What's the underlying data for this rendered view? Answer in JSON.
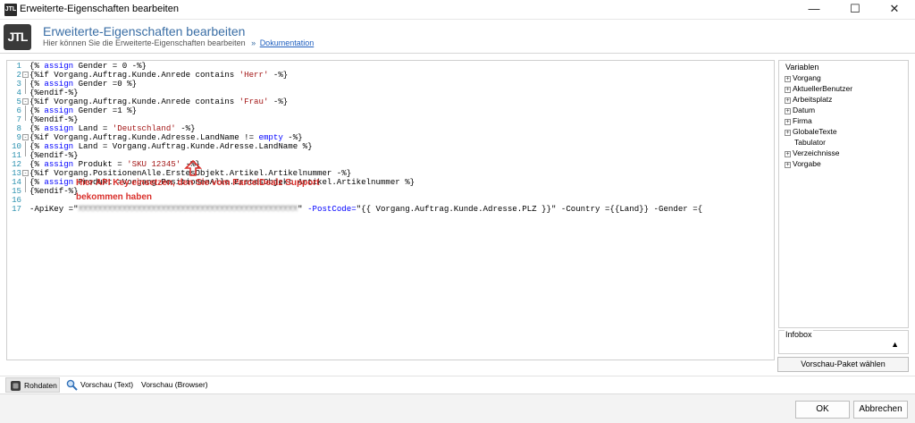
{
  "window": {
    "app_icon_text": "JTL",
    "title": "Erweiterte-Eigenschaften bearbeiten",
    "minimize_glyph": "—",
    "maximize_glyph": "☐",
    "close_glyph": "✕"
  },
  "header": {
    "logo_text": "JTL",
    "title": "Erweiterte-Eigenschaften bearbeiten",
    "subtitle": "Hier können Sie die Erweiterte-Eigenschaften bearbeiten",
    "separator": "»",
    "doc_link": "Dokumentation"
  },
  "editor": {
    "lines": [
      {
        "num": "1",
        "fold": "",
        "parts": [
          {
            "t": "{% "
          },
          {
            "t": "assign",
            "c": "kw"
          },
          {
            "t": " Gender = 0 -%}"
          }
        ]
      },
      {
        "num": "2",
        "fold": "-",
        "parts": [
          {
            "t": "{%if Vorgang.Auftrag.Kunde.Anrede contains "
          },
          {
            "t": "'Herr'",
            "c": "str"
          },
          {
            "t": " -%}"
          }
        ]
      },
      {
        "num": "3",
        "fold": "",
        "parts": [
          {
            "t": "{% "
          },
          {
            "t": "assign",
            "c": "kw"
          },
          {
            "t": " Gender =0 %}"
          }
        ]
      },
      {
        "num": "4",
        "fold": "",
        "parts": [
          {
            "t": "{%endif-%}"
          }
        ]
      },
      {
        "num": "5",
        "fold": "-",
        "parts": [
          {
            "t": "{%if Vorgang.Auftrag.Kunde.Anrede contains "
          },
          {
            "t": "'Frau'",
            "c": "str"
          },
          {
            "t": " -%}"
          }
        ]
      },
      {
        "num": "6",
        "fold": "",
        "parts": [
          {
            "t": "{% "
          },
          {
            "t": "assign",
            "c": "kw"
          },
          {
            "t": " Gender =1 %}"
          }
        ]
      },
      {
        "num": "7",
        "fold": "",
        "parts": [
          {
            "t": "{%endif-%}"
          }
        ]
      },
      {
        "num": "8",
        "fold": "",
        "parts": [
          {
            "t": "{% "
          },
          {
            "t": "assign",
            "c": "kw"
          },
          {
            "t": " Land = "
          },
          {
            "t": "'Deutschland'",
            "c": "str"
          },
          {
            "t": " -%}"
          }
        ]
      },
      {
        "num": "9",
        "fold": "-",
        "parts": [
          {
            "t": "{%if Vorgang.Auftrag.Kunde.Adresse.LandName != "
          },
          {
            "t": "empty",
            "c": "kw"
          },
          {
            "t": " -%}"
          }
        ]
      },
      {
        "num": "10",
        "fold": "",
        "parts": [
          {
            "t": "{% "
          },
          {
            "t": "assign",
            "c": "kw"
          },
          {
            "t": " Land = Vorgang.Auftrag.Kunde.Adresse.LandName %}"
          }
        ]
      },
      {
        "num": "11",
        "fold": "",
        "parts": [
          {
            "t": "{%endif-%}"
          }
        ]
      },
      {
        "num": "12",
        "fold": "",
        "parts": [
          {
            "t": "{% "
          },
          {
            "t": "assign",
            "c": "kw"
          },
          {
            "t": " Produkt = "
          },
          {
            "t": "'SKU 12345'",
            "c": "str"
          },
          {
            "t": " -%}"
          }
        ]
      },
      {
        "num": "13",
        "fold": "-",
        "parts": [
          {
            "t": "{%if Vorgang.PositionenAlle.ErstesObjekt.Artikel.Artikelnummer -%}"
          }
        ]
      },
      {
        "num": "14",
        "fold": "",
        "parts": [
          {
            "t": "{% "
          },
          {
            "t": "assign",
            "c": "kw"
          },
          {
            "t": " Produkt =Vorgang.PositionenAlle.ErstesObjekt.Artikel.Artikelnummer %}"
          }
        ]
      },
      {
        "num": "15",
        "fold": "",
        "parts": [
          {
            "t": "{%endif-%}"
          }
        ]
      },
      {
        "num": "16",
        "fold": "",
        "parts": []
      },
      {
        "num": "17",
        "fold": "",
        "parts": [
          {
            "t": "-ApiKey =\""
          },
          {
            "t": "XXXXXXXXXXXXXXXXXXXXXXXXXXXXXXXXXXXXXXXXXXXXX",
            "c": "redact"
          },
          {
            "t": "\" "
          },
          {
            "t": "-PostCode=",
            "c": "kw"
          },
          {
            "t": "\"{{ Vorgang.Auftrag.Kunde.Adresse.PLZ }}\" -Country ={{Land}} -Gender ={"
          }
        ]
      }
    ]
  },
  "annotation": {
    "line1": "Hier API Key einsetzen, den Sie vom ParcelDealz Support",
    "line2": "bekommen haben",
    "color": "#d9302c"
  },
  "variables": {
    "legend": "Variablen",
    "items": [
      {
        "label": "Vorgang",
        "expandable": true
      },
      {
        "label": "AktuellerBenutzer",
        "expandable": true
      },
      {
        "label": "Arbeitsplatz",
        "expandable": true
      },
      {
        "label": "Datum",
        "expandable": true
      },
      {
        "label": "Firma",
        "expandable": true
      },
      {
        "label": "GlobaleTexte",
        "expandable": true
      },
      {
        "label": "Tabulator",
        "expandable": false
      },
      {
        "label": "Verzeichnisse",
        "expandable": true
      },
      {
        "label": "Vorgabe",
        "expandable": true
      }
    ],
    "expander_glyph": "+"
  },
  "infobox": {
    "legend": "Infobox",
    "toggle_glyph": "▲"
  },
  "preview_button": "Vorschau-Paket wählen",
  "tabs": [
    {
      "label": "Rohdaten",
      "active": true
    },
    {
      "label": "Vorschau (Text)",
      "active": false
    },
    {
      "label": "Vorschau (Browser)",
      "active": false
    }
  ],
  "footer": {
    "ok": "OK",
    "cancel": "Abbrechen"
  },
  "colors": {
    "keyword": "#0000ff",
    "string": "#a31515",
    "line_number": "#2b91af",
    "header_title": "#3a6ea5",
    "link": "#1f5fbf"
  }
}
